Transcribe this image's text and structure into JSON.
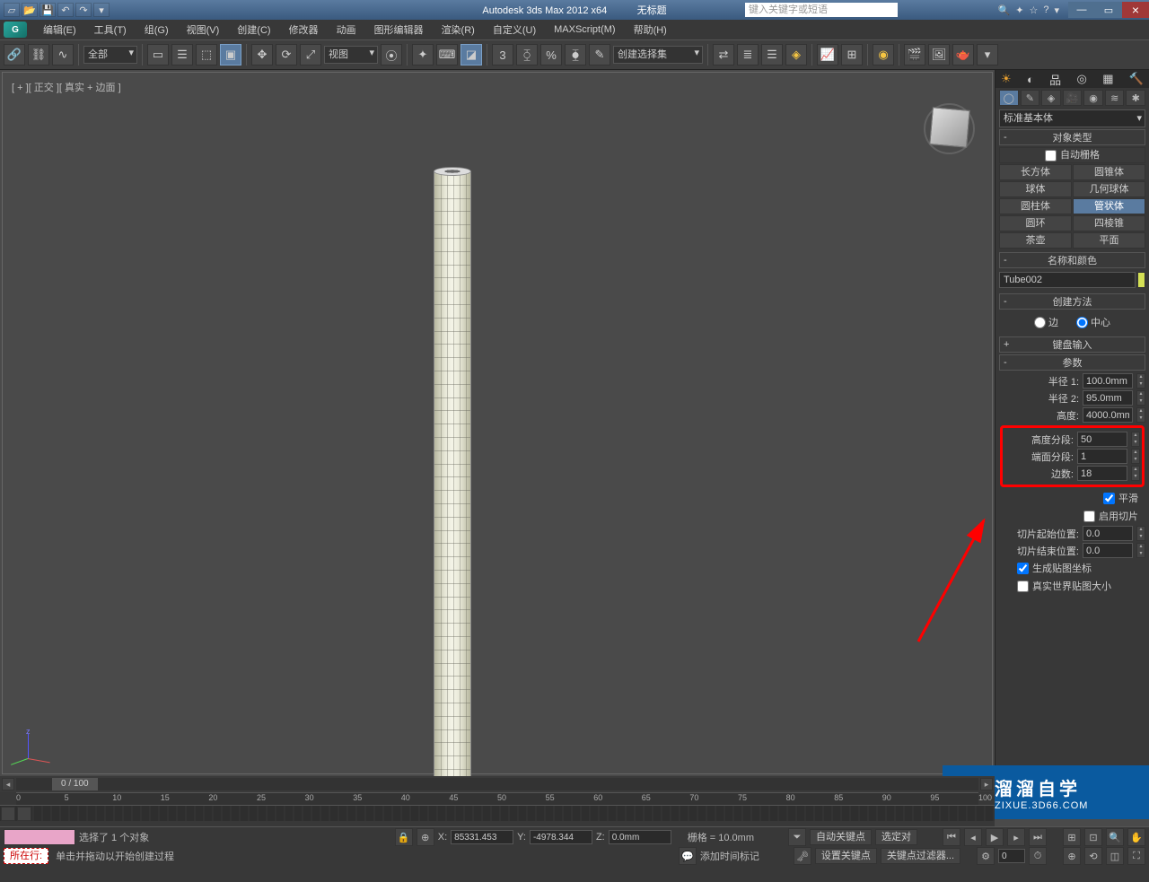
{
  "title_bar": {
    "app": "Autodesk 3ds Max 2012 x64",
    "doc": "无标题",
    "search_placeholder": "键入关键字或短语"
  },
  "menu": {
    "edit": "编辑(E)",
    "tools": "工具(T)",
    "group": "组(G)",
    "views": "视图(V)",
    "create": "创建(C)",
    "modifiers": "修改器",
    "animation": "动画",
    "graph": "图形编辑器",
    "rendering": "渲染(R)",
    "customize": "自定义(U)",
    "maxscript": "MAXScript(M)",
    "help": "帮助(H)"
  },
  "toolbar": {
    "all": "全部",
    "view": "视图",
    "selset": "创建选择集"
  },
  "viewport": {
    "label": "[ + ][ 正交 ][ 真实 + 边面 ]"
  },
  "panel": {
    "category": "标准基本体",
    "rollout_objtype": "对象类型",
    "auto_grid": "自动栅格",
    "primitives": {
      "box": "长方体",
      "cone": "圆锥体",
      "sphere": "球体",
      "geosphere": "几何球体",
      "cylinder": "圆柱体",
      "tube": "管状体",
      "torus": "圆环",
      "pyramid": "四棱锥",
      "teapot": "茶壶",
      "plane": "平面"
    },
    "rollout_name": "名称和颜色",
    "obj_name": "Tube002",
    "rollout_method": "创建方法",
    "method_edge": "边",
    "method_center": "中心",
    "rollout_keyboard": "键盘输入",
    "rollout_params": "参数",
    "params": {
      "radius1_lbl": "半径 1:",
      "radius1": "100.0mm",
      "radius2_lbl": "半径 2:",
      "radius2": "95.0mm",
      "height_lbl": "高度:",
      "height": "4000.0mm",
      "heightsegs_lbl": "高度分段:",
      "heightsegs": "50",
      "capsegs_lbl": "端面分段:",
      "capsegs": "1",
      "sides_lbl": "边数:",
      "sides": "18",
      "smooth": "平滑",
      "slice_on": "启用切片",
      "slice_from_lbl": "切片起始位置:",
      "slice_from": "0.0",
      "slice_to_lbl": "切片结束位置:",
      "slice_to": "0.0",
      "gen_uv": "生成贴图坐标",
      "real_world": "真实世界贴图大小"
    }
  },
  "timeline": {
    "frame": "0 / 100",
    "ticks": [
      "0",
      "5",
      "10",
      "15",
      "20",
      "25",
      "30",
      "35",
      "40",
      "45",
      "50",
      "55",
      "60",
      "65",
      "70",
      "75",
      "80",
      "85",
      "90",
      "95",
      "100"
    ]
  },
  "status": {
    "line": "所在行:",
    "selected": "选择了 1 个对象",
    "prompt": "单击并拖动以开始创建过程",
    "x_lbl": "X:",
    "x": "85331.453",
    "y_lbl": "Y:",
    "y": "-4978.344",
    "z_lbl": "Z:",
    "z": "0.0mm",
    "grid": "栅格 = 10.0mm",
    "add_time_tag": "添加时间标记",
    "auto_key": "自动关键点",
    "selected2": "选定对",
    "set_key": "设置关键点",
    "key_filter": "关键点过滤器..."
  },
  "watermark": {
    "main": "溜溜自学",
    "sub": "ZIXUE.3D66.COM"
  }
}
